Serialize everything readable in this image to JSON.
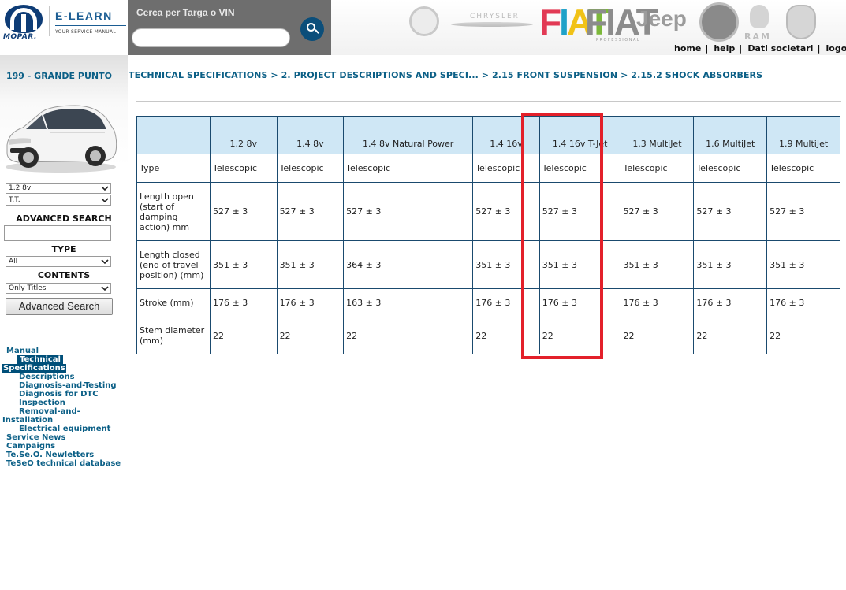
{
  "header": {
    "logo_text": "MOPAR.",
    "app_title": "E-LEARN",
    "app_subtitle": "YOUR SERVICE MANUAL",
    "search_label": "Cerca per Targa o VIN",
    "search_value": "",
    "brands": {
      "chrysler": "CHRYSLER",
      "fiat": "FIAT",
      "fiat_pro": "FIAT",
      "fiat_pro_sub": "PROFESSIONAL",
      "jeep": "Jeep",
      "ram": "RAM"
    },
    "links": [
      "home",
      "help",
      "Dati societari",
      "logout"
    ]
  },
  "sidebar": {
    "model": "199 - GRANDE PUNTO",
    "engine_select": "1.2 8v",
    "variant_select": "T.T.",
    "advanced_search_heading": "ADVANCED SEARCH",
    "advanced_search_value": "",
    "type_heading": "TYPE",
    "type_select": "All",
    "contents_heading": "CONTENTS",
    "contents_select": "Only Titles",
    "advanced_search_button": "Advanced Search",
    "nav": [
      "Manual",
      "Technical",
      "Specifications",
      "Descriptions",
      "Diagnosis-and-Testing",
      "Diagnosis for DTC",
      "Inspection",
      "Removal-and-",
      "Installation",
      "Electrical equipment",
      "Service News",
      "Campaigns",
      "Te.Se.O. Newletters",
      "TeSeO technical database"
    ]
  },
  "breadcrumb": "TECHNICAL SPECIFICATIONS > 2. PROJECT DESCRIPTIONS AND SPECI... > 2.15 FRONT SUSPENSION > 2.15.2 SHOCK ABSORBERS",
  "table": {
    "columns": [
      "1.2 8v",
      "1.4 8v",
      "1.4 8v Natural Power",
      "1.4 16v",
      "1.4 16v T-Jet",
      "1.3 MultiJet",
      "1.6 MultiJet",
      "1.9 MultiJet"
    ],
    "highlighted_column": "1.4 16v T-Jet",
    "rows": [
      {
        "label": "Type",
        "values": [
          "Telescopic",
          "Telescopic",
          "Telescopic",
          "Telescopic",
          "Telescopic",
          "Telescopic",
          "Telescopic",
          "Telescopic"
        ]
      },
      {
        "label": "Length open (start of damping action) mm",
        "values": [
          "527 ± 3",
          "527 ± 3",
          "527 ± 3",
          "527 ± 3",
          "527 ± 3",
          "527 ± 3",
          "527 ± 3",
          "527 ± 3"
        ]
      },
      {
        "label": "Length closed (end of travel position) (mm)",
        "values": [
          "351 ± 3",
          "351 ± 3",
          "364 ± 3",
          "351 ± 3",
          "351 ± 3",
          "351 ± 3",
          "351 ± 3",
          "351 ± 3"
        ]
      },
      {
        "label": "Stroke (mm)",
        "values": [
          "176 ± 3",
          "176 ± 3",
          "163 ± 3",
          "176 ± 3",
          "176 ± 3",
          "176 ± 3",
          "176 ± 3",
          "176 ± 3"
        ]
      },
      {
        "label": "Stem diameter (mm)",
        "values": [
          "22",
          "22",
          "22",
          "22",
          "22",
          "22",
          "22",
          "22"
        ]
      }
    ]
  },
  "colors": {
    "accent": "#0b5f86",
    "header_cell": "#cfe7f5",
    "highlight": "#e3202a",
    "nav_active_bg": "#004f79"
  }
}
